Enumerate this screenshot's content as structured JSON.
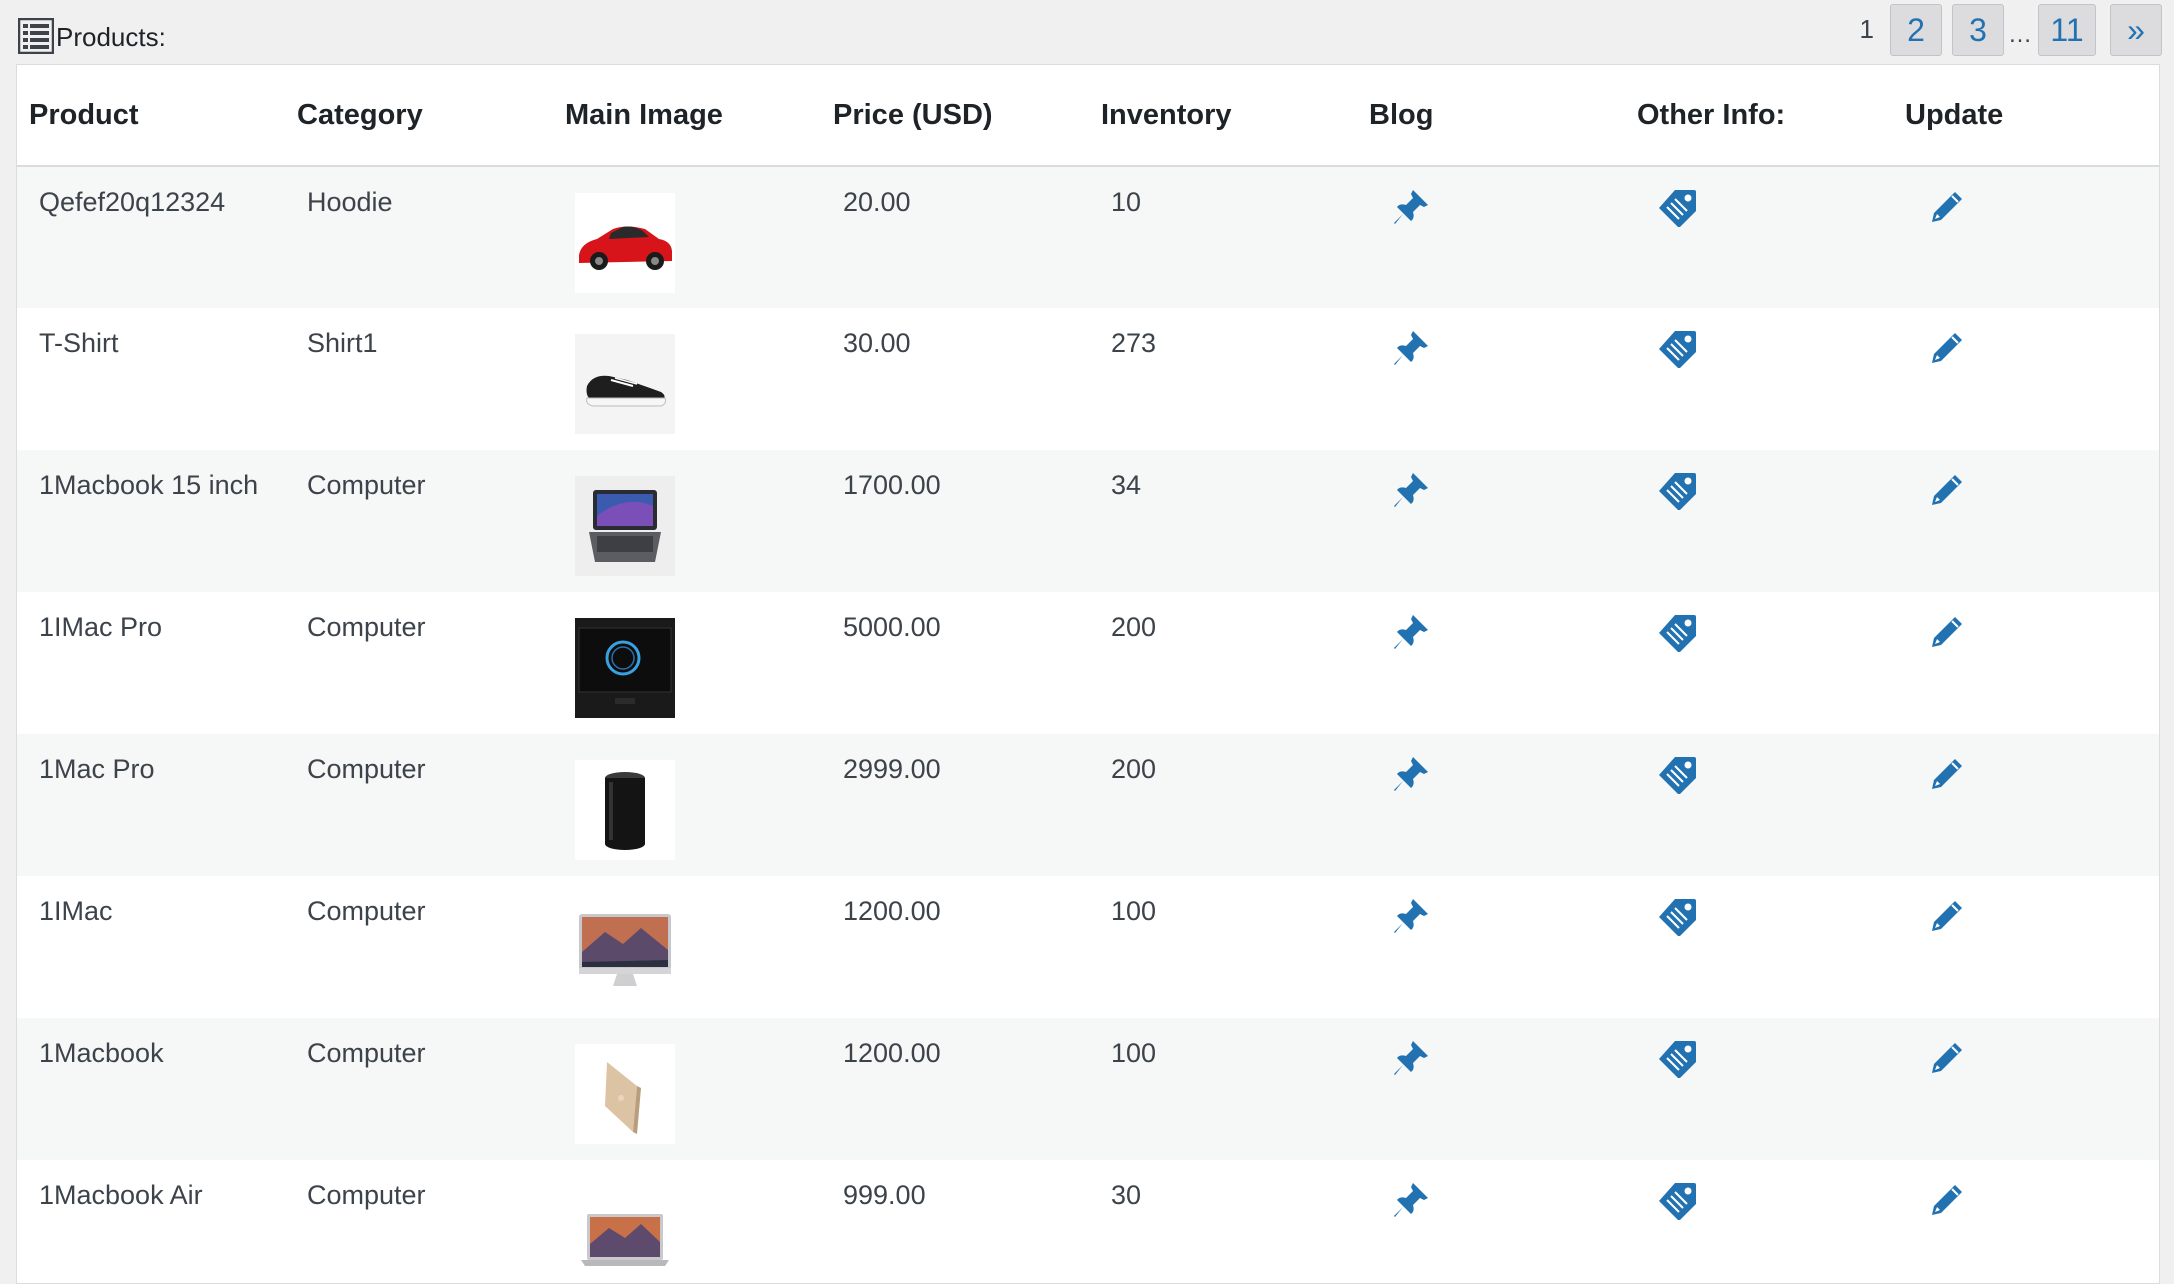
{
  "header": {
    "title": "Products:",
    "icon": "list-icon"
  },
  "pagination": {
    "current": "1",
    "pages": [
      "2",
      "3"
    ],
    "ellipsis": "…",
    "last_page": "11",
    "next": "»"
  },
  "table": {
    "columns": [
      "Product",
      "Category",
      "Main Image",
      "Price (USD)",
      "Inventory",
      "Blog",
      "Other Info:",
      "Update"
    ],
    "rows": [
      {
        "product": "Qefef20q12324",
        "category": "Hoodie",
        "image": "red-car",
        "price": "20.00",
        "inventory": "10"
      },
      {
        "product": "T-Shirt",
        "category": "Shirt1",
        "image": "sneaker",
        "price": "30.00",
        "inventory": "273"
      },
      {
        "product": "1Macbook 15 inch",
        "category": "Computer",
        "image": "laptop-dark",
        "price": "1700.00",
        "inventory": "34"
      },
      {
        "product": "1IMac Pro",
        "category": "Computer",
        "image": "imac-pro-dark",
        "price": "5000.00",
        "inventory": "200"
      },
      {
        "product": "1Mac Pro",
        "category": "Computer",
        "image": "mac-pro-cylinder",
        "price": "2999.00",
        "inventory": "200"
      },
      {
        "product": "1IMac",
        "category": "Computer",
        "image": "imac-mountain",
        "price": "1200.00",
        "inventory": "100"
      },
      {
        "product": "1Macbook",
        "category": "Computer",
        "image": "macbook-gold",
        "price": "1200.00",
        "inventory": "100"
      },
      {
        "product": "1Macbook Air",
        "category": "Computer",
        "image": "macbook-air-mountain",
        "price": "999.00",
        "inventory": "30"
      }
    ]
  },
  "icons": {
    "blog": "pin-icon",
    "other_info": "tag-icon",
    "update": "pencil-icon"
  },
  "colors": {
    "accent": "#2271b1",
    "background": "#f0f0f1",
    "row_alt": "#f6f7f7"
  }
}
